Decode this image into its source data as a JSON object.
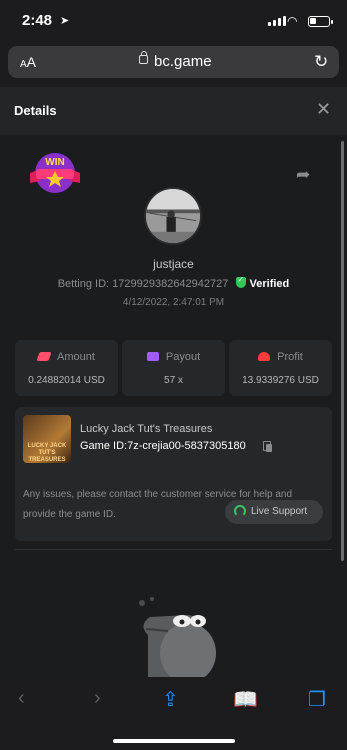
{
  "status_bar": {
    "time": "2:48"
  },
  "browser": {
    "text_size_label": "AA",
    "domain": "bc.game"
  },
  "header": {
    "title": "Details"
  },
  "badge": {
    "text": "WIN"
  },
  "player": {
    "username": "justjace",
    "betting_id_label": "Betting ID:",
    "betting_id": "1729929382642942727",
    "verified_label": "Verified",
    "date": "4/12/2022, 2:47:01 PM"
  },
  "stats": [
    {
      "label": "Amount",
      "value": "0.24882014 USD",
      "icon_color": "#ff4f6d",
      "icon": "ticket-icon"
    },
    {
      "label": "Payout",
      "value": "57 x",
      "icon_color": "#a05cff",
      "icon": "wallet-icon"
    },
    {
      "label": "Profit",
      "value": "13.9339276 USD",
      "icon_color": "#ff3b3b",
      "icon": "coins-icon"
    }
  ],
  "game": {
    "thumb_text": "LUCKY JACK TUT'S TREASURES",
    "name": "Lucky Jack Tut's Treasures",
    "id_label": "Game ID:",
    "id": "7z-crejia00-5837305180",
    "note": "Any issues, please contact the customer service for help and provide the game ID.",
    "support_label": "Live Support"
  },
  "colors": {
    "verified": "#34c759",
    "accent": "#1e90ff"
  }
}
